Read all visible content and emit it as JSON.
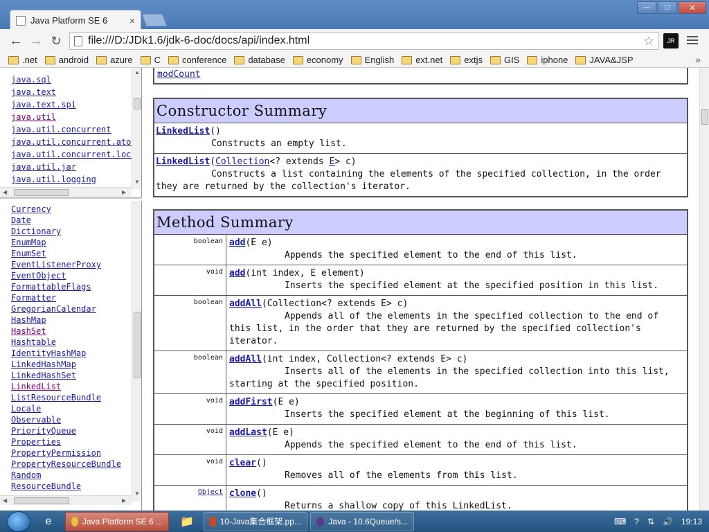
{
  "browser": {
    "tab_title": "Java Platform SE 6",
    "tab_close": "×",
    "url": "file:///D:/JDk1.6/jdk-6-doc/docs/api/index.html",
    "window_controls": [
      "—",
      "□",
      "✕"
    ],
    "ext_label": "JR",
    "bookmarks": [
      ".net",
      "android",
      "azure",
      "C",
      "conference",
      "database",
      "economy",
      "English",
      "ext.net",
      "extjs",
      "GIS",
      "iphone",
      "JAVA&JSP"
    ],
    "bookmarks_more": "»"
  },
  "packages": [
    {
      "name": "java.sql",
      "visited": false
    },
    {
      "name": "java.text",
      "visited": false
    },
    {
      "name": "java.text.spi",
      "visited": false
    },
    {
      "name": "java.util",
      "visited": true
    },
    {
      "name": "java.util.concurrent",
      "visited": false
    },
    {
      "name": "java.util.concurrent.atom",
      "visited": false
    },
    {
      "name": "java.util.concurrent.lock",
      "visited": false
    },
    {
      "name": "java.util.jar",
      "visited": false
    },
    {
      "name": "java.util.logging",
      "visited": false
    }
  ],
  "classes": [
    {
      "name": "Currency",
      "visited": false
    },
    {
      "name": "Date",
      "visited": false
    },
    {
      "name": "Dictionary",
      "visited": false
    },
    {
      "name": "EnumMap",
      "visited": false
    },
    {
      "name": "EnumSet",
      "visited": false
    },
    {
      "name": "EventListenerProxy",
      "visited": false
    },
    {
      "name": "EventObject",
      "visited": false
    },
    {
      "name": "FormattableFlags",
      "visited": false
    },
    {
      "name": "Formatter",
      "visited": false
    },
    {
      "name": "GregorianCalendar",
      "visited": false
    },
    {
      "name": "HashMap",
      "visited": false
    },
    {
      "name": "HashSet",
      "visited": true
    },
    {
      "name": "Hashtable",
      "visited": false
    },
    {
      "name": "IdentityHashMap",
      "visited": false
    },
    {
      "name": "LinkedHashMap",
      "visited": false
    },
    {
      "name": "LinkedHashSet",
      "visited": false
    },
    {
      "name": "LinkedList",
      "visited": true
    },
    {
      "name": "ListResourceBundle",
      "visited": false
    },
    {
      "name": "Locale",
      "visited": false
    },
    {
      "name": "Observable",
      "visited": false
    },
    {
      "name": "PriorityQueue",
      "visited": false
    },
    {
      "name": "Properties",
      "visited": false
    },
    {
      "name": "PropertyPermission",
      "visited": false
    },
    {
      "name": "PropertyResourceBundle",
      "visited": false
    },
    {
      "name": "Random",
      "visited": false
    },
    {
      "name": "ResourceBundle",
      "visited": false
    }
  ],
  "main": {
    "top_link": "modCount",
    "constructor_summary": {
      "title": "Constructor Summary",
      "rows": [
        {
          "sig": "LinkedList",
          "params": "()",
          "desc": "Constructs an empty list."
        },
        {
          "sig": "LinkedList",
          "params_pre": "(",
          "param_link": "Collection",
          "params_mid": "<? extends ",
          "param_type": "E",
          "params_post": "> c)",
          "desc": "Constructs a list containing the elements of the specified collection, in the order",
          "desc2": "they are returned by the collection's iterator."
        }
      ]
    },
    "method_summary": {
      "title": "Method Summary",
      "rows": [
        {
          "type": "boolean",
          "name": "add",
          "params": "(E e)",
          "desc": "Appends the specified element to the end of this list."
        },
        {
          "type": "void",
          "name": "add",
          "params": "(int index, E element)",
          "desc": "Inserts the specified element at the specified position in this list."
        },
        {
          "type": "boolean",
          "name": "addAll",
          "params": "(Collection<? extends E> c)",
          "desc": "Appends all of the elements in the specified collection to the end of",
          "desc2": "this list, in the order that they are returned by the specified collection's",
          "desc3": "iterator."
        },
        {
          "type": "boolean",
          "name": "addAll",
          "params": "(int index, Collection<? extends E> c)",
          "desc": "Inserts all of the elements in the specified collection into this list,",
          "desc2": "starting at the specified position."
        },
        {
          "type": "void",
          "name": "addFirst",
          "params": "(E e)",
          "desc": "Inserts the specified element at the beginning of this list."
        },
        {
          "type": "void",
          "name": "addLast",
          "params": "(E e)",
          "desc": "Appends the specified element to the end of this list."
        },
        {
          "type": "void",
          "name": "clear",
          "params": "()",
          "desc": "Removes all of the elements from this list."
        },
        {
          "type": "Object",
          "name": "clone",
          "params": "()",
          "desc": "Returns a shallow copy of this LinkedList."
        }
      ]
    }
  },
  "taskbar": {
    "tasks": [
      "Java Platform SE 6 ...",
      "10-Java集合框架.pp...",
      "Java - 10.6Queue/s..."
    ],
    "clock": "19:13"
  }
}
